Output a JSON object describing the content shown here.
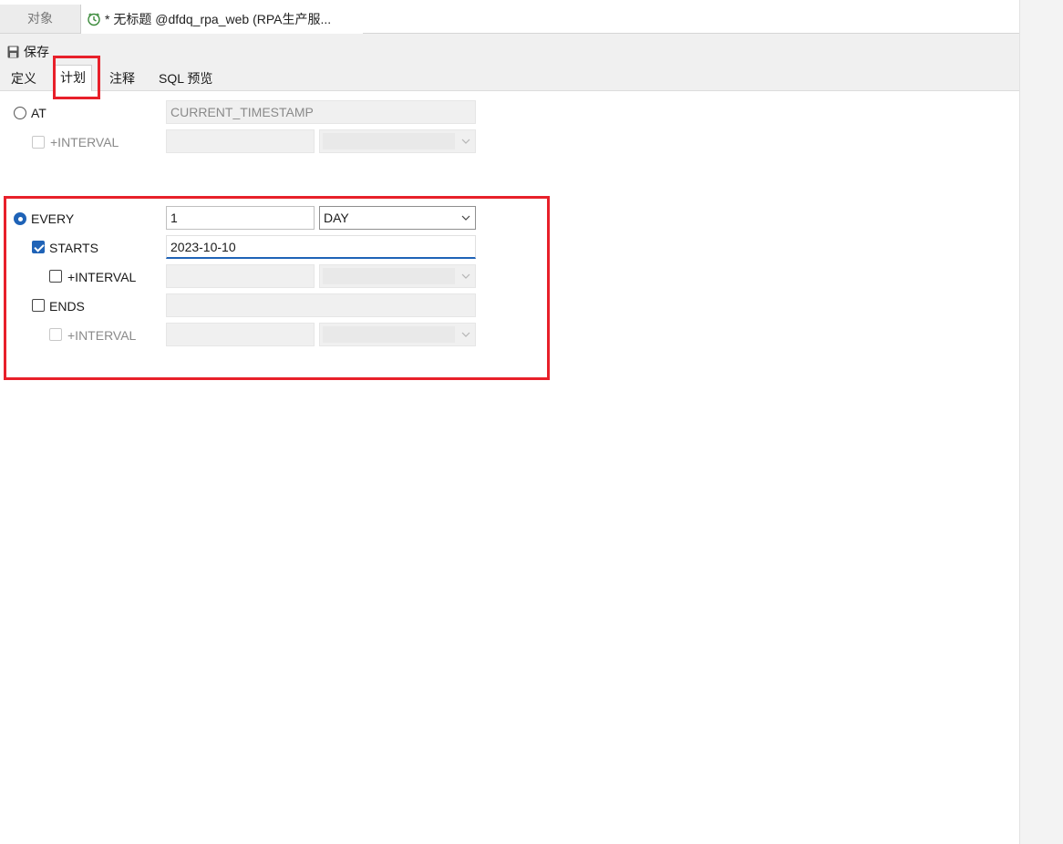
{
  "tabs": {
    "objects_label": "对象",
    "document_title": "* 无标题 @dfdq_rpa_web (RPA生产服..."
  },
  "toolbar": {
    "save_label": "保存"
  },
  "subtabs": [
    "定义",
    "计划",
    "注释",
    "SQL 预览"
  ],
  "active_subtab": "计划",
  "schedule": {
    "at": {
      "label": "AT",
      "selected": false,
      "value": "CURRENT_TIMESTAMP",
      "interval": {
        "label": "+INTERVAL",
        "checked": false,
        "enabled": false,
        "value": "",
        "unit": ""
      }
    },
    "every": {
      "label": "EVERY",
      "selected": true,
      "value": "1",
      "unit": "DAY",
      "starts": {
        "label": "STARTS",
        "checked": true,
        "value": "2023-10-10",
        "interval": {
          "label": "+INTERVAL",
          "checked": false,
          "enabled": true,
          "value": "",
          "unit": ""
        }
      },
      "ends": {
        "label": "ENDS",
        "checked": false,
        "value": "",
        "interval": {
          "label": "+INTERVAL",
          "checked": false,
          "enabled": false,
          "value": "",
          "unit": ""
        }
      }
    }
  },
  "colors": {
    "accent": "#1f63b7",
    "highlight": "#e8202a"
  }
}
